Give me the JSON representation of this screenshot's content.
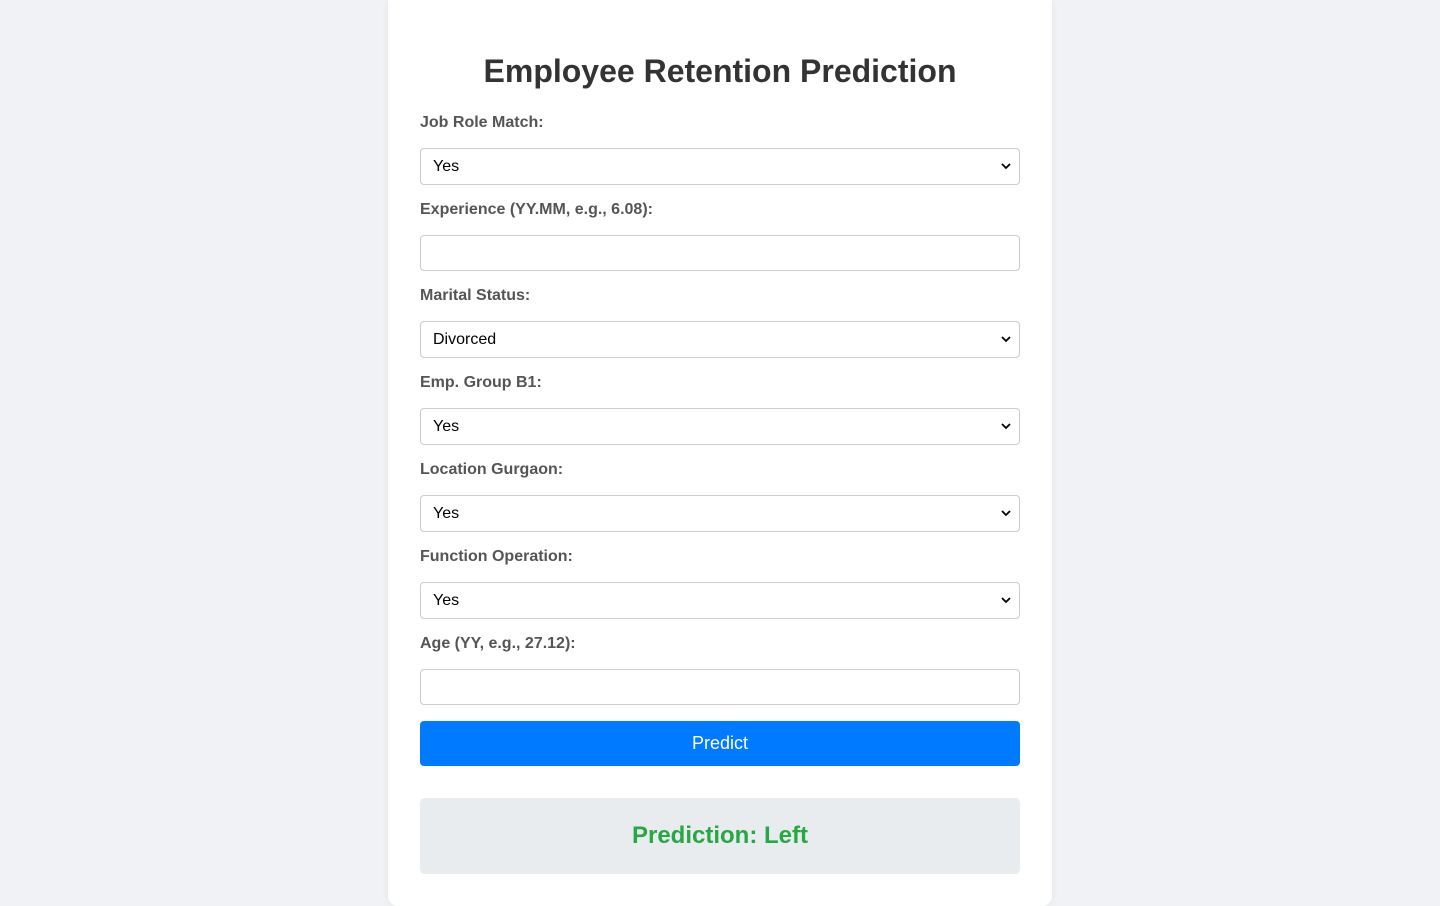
{
  "form": {
    "title": "Employee Retention Prediction",
    "fields": [
      {
        "label": "Job Role Match:",
        "type": "select",
        "value": "Yes"
      },
      {
        "label": "Experience (YY.MM, e.g., 6.08):",
        "type": "input",
        "value": ""
      },
      {
        "label": "Marital Status:",
        "type": "select",
        "value": "Divorced"
      },
      {
        "label": "Emp. Group B1:",
        "type": "select",
        "value": "Yes"
      },
      {
        "label": "Location Gurgaon:",
        "type": "select",
        "value": "Yes"
      },
      {
        "label": "Function Operation:",
        "type": "select",
        "value": "Yes"
      },
      {
        "label": "Age (YY, e.g., 27.12):",
        "type": "input",
        "value": ""
      }
    ],
    "predict_label": "Predict"
  },
  "result": {
    "text": "Prediction: Left",
    "color": "#28a745"
  },
  "colors": {
    "accent": "#007bff",
    "background": "#f0f2f5",
    "result_bg": "#e9ecef"
  }
}
